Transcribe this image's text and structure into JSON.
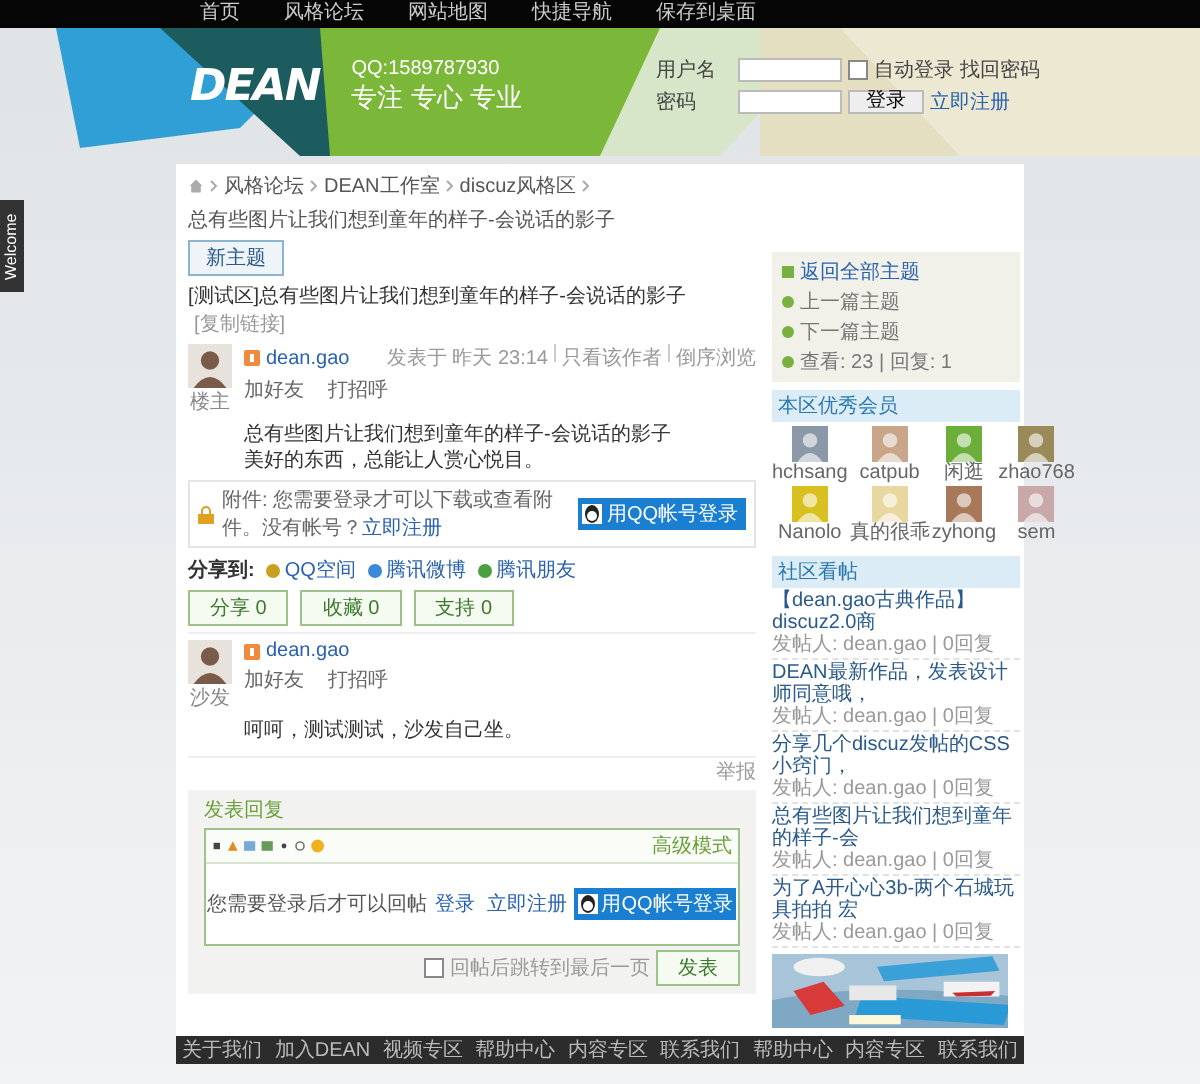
{
  "top_nav": [
    "首页",
    "风格论坛",
    "网站地图",
    "快捷导航",
    "保存到桌面"
  ],
  "header": {
    "logo": "DEAN",
    "qq": "QQ:1589787930",
    "slogan": "专注 专心 专业"
  },
  "login": {
    "username_label": "用户名",
    "password_label": "密码",
    "auto_login": {
      "label": "自动登录",
      "checked": false
    },
    "forgot": "找回密码",
    "button": "登录",
    "register": "立即注册"
  },
  "side_tab": "Welcome",
  "breadcrumb": [
    "风格论坛",
    "DEAN工作室",
    "discuz风格区",
    "总有些图片让我们想到童年的样子-会说话的影子"
  ],
  "new_topic": "新主题",
  "thread": {
    "tag": "[测试区]",
    "title": "总有些图片让我们想到童年的样子-会说话的影子",
    "copy_link": "[复制链接]"
  },
  "posts": [
    {
      "author": "dean.gao",
      "actions": [
        "加好友",
        "打招呼"
      ],
      "floor": "楼主",
      "meta": [
        "发表于 昨天 23:14",
        "只看该作者",
        "倒序浏览"
      ],
      "body": [
        "总有些图片让我们想到童年的样子-会说话的影子",
        "美好的东西，总能让人赏心悦目。"
      ]
    },
    {
      "author": "dean.gao",
      "actions": [
        "加好友",
        "打招呼"
      ],
      "floor": "沙发",
      "body": [
        "呵呵，测试测试，沙发自己坐。"
      ]
    }
  ],
  "attachment": {
    "text": "附件: 您需要登录才可以下载或查看附件。没有帐号？",
    "link": "立即注册",
    "qq_button": "用QQ帐号登录"
  },
  "share": {
    "label": "分享到:",
    "targets": [
      "QQ空间",
      "腾讯微博",
      "腾讯朋友"
    ],
    "buttons": [
      "分享 0",
      "收藏 0",
      "支持 0"
    ]
  },
  "report": "举报",
  "reply": {
    "title": "发表回复",
    "advanced": "高级模式",
    "prompt": "您需要登录后才可以回帖",
    "login": "登录",
    "register": "立即注册",
    "qq_button": "用QQ帐号登录",
    "jump": {
      "label": "回帖后跳转到最后一页",
      "checked": false
    },
    "submit": "发表"
  },
  "thread_nav": [
    "返回全部主题",
    "上一篇主题",
    "下一篇主题",
    "查看: 23 | 回复: 1"
  ],
  "members": {
    "title": "本区优秀会员",
    "items": [
      "hchsang",
      "catpub",
      "闲逛",
      "zhao768",
      "Nanolo",
      "真的很乖",
      "zyhong",
      "sem"
    ]
  },
  "community": {
    "title": "社区看帖",
    "items": [
      {
        "title": "【dean.gao古典作品】discuz2.0商",
        "meta": "发帖人: dean.gao | 0回复"
      },
      {
        "title": "DEAN最新作品，发表设计师同意哦，",
        "meta": "发帖人: dean.gao | 0回复"
      },
      {
        "title": "分享几个discuz发帖的CSS小窍门，",
        "meta": "发帖人: dean.gao | 0回复"
      },
      {
        "title": "总有些图片让我们想到童年的样子-会",
        "meta": "发帖人: dean.gao | 0回复"
      },
      {
        "title": "为了A开心心3b-两个石城玩具拍拍 宏",
        "meta": "发帖人: dean.gao | 0回复"
      }
    ]
  },
  "ad": {
    "kind": "picture"
  },
  "footer": [
    "关于我们",
    "加入DEAN",
    "视频专区",
    "帮助中心",
    "内容专区",
    "联系我们",
    "帮助中心",
    "内容专区",
    "联系我们"
  ]
}
